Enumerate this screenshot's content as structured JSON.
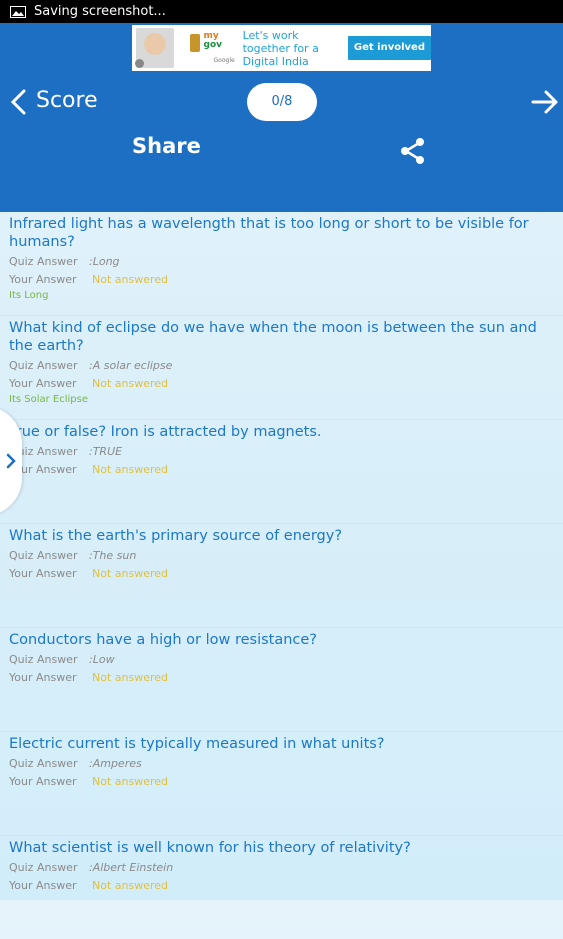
{
  "status_bar": {
    "notification_text": "Saving screenshot..."
  },
  "ad": {
    "logo_top": "my",
    "logo_bottom": "gov",
    "logo_sub": "Google",
    "tagline": "Let's work together for a Digital India",
    "cta_label": "Get involved"
  },
  "header": {
    "title": "Score",
    "score_display": "0/8",
    "share_label": "Share"
  },
  "labels": {
    "quiz_answer": "Quiz Answer",
    "your_answer": "Your Answer"
  },
  "questions": [
    {
      "question": "Infrared light has a wavelength that is too long or short to be visible for humans?",
      "quiz_answer": ":Long",
      "your_answer": "Not answered",
      "explanation": "Its Long"
    },
    {
      "question": "What kind of eclipse do we have when the moon is between the sun and the earth?",
      "quiz_answer": ":A solar eclipse",
      "your_answer": "Not answered",
      "explanation": "Its Solar Eclipse"
    },
    {
      "question": "True or false? Iron is attracted by magnets.",
      "quiz_answer": ":TRUE",
      "your_answer": "Not answered",
      "explanation": ""
    },
    {
      "question": "What is the earth's primary source of energy?",
      "quiz_answer": ":The sun",
      "your_answer": "Not answered",
      "explanation": ""
    },
    {
      "question": "Conductors have a high or low resistance?",
      "quiz_answer": ":Low",
      "your_answer": "Not answered",
      "explanation": ""
    },
    {
      "question": "Electric current is typically measured in what units?",
      "quiz_answer": ":Amperes",
      "your_answer": "Not answered",
      "explanation": ""
    },
    {
      "question": "What scientist is well known for his theory of relativity?",
      "quiz_answer": ":Albert Einstein",
      "your_answer": "Not answered",
      "explanation": ""
    }
  ]
}
